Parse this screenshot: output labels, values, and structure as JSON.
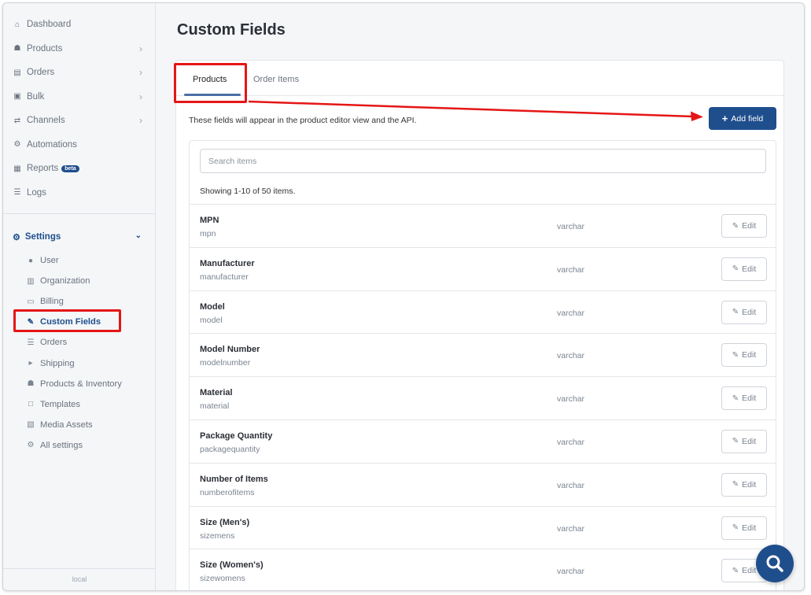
{
  "sidebar": {
    "nav": [
      {
        "label": "Dashboard",
        "icon": "home-icon"
      },
      {
        "label": "Products",
        "icon": "products-icon"
      },
      {
        "label": "Orders",
        "icon": "orders-icon"
      },
      {
        "label": "Bulk",
        "icon": "bulk-icon"
      },
      {
        "label": "Channels",
        "icon": "channels-icon"
      },
      {
        "label": "Automations",
        "icon": "automations-icon"
      },
      {
        "label": "Reports",
        "icon": "reports-icon",
        "badge": "beta"
      },
      {
        "label": "Logs",
        "icon": "logs-icon"
      }
    ],
    "settings": {
      "label": "Settings",
      "items": [
        {
          "label": "User"
        },
        {
          "label": "Organization"
        },
        {
          "label": "Billing"
        },
        {
          "label": "Custom Fields"
        },
        {
          "label": "Orders"
        },
        {
          "label": "Shipping"
        },
        {
          "label": "Products & Inventory"
        },
        {
          "label": "Templates"
        },
        {
          "label": "Media Assets"
        },
        {
          "label": "All settings"
        }
      ]
    },
    "footer": "local"
  },
  "main": {
    "title": "Custom Fields",
    "tabs": [
      {
        "label": "Products"
      },
      {
        "label": "Order Items"
      }
    ],
    "description": "These fields will appear in the product editor view and the API.",
    "add_button": "Add field",
    "search": {
      "placeholder": "Search items"
    },
    "showing": "Showing 1-10 of 50 items.",
    "edit_label": "Edit",
    "rows": [
      {
        "name": "MPN",
        "key": "mpn",
        "type": "varchar"
      },
      {
        "name": "Manufacturer",
        "key": "manufacturer",
        "type": "varchar"
      },
      {
        "name": "Model",
        "key": "model",
        "type": "varchar"
      },
      {
        "name": "Model Number",
        "key": "modelnumber",
        "type": "varchar"
      },
      {
        "name": "Material",
        "key": "material",
        "type": "varchar"
      },
      {
        "name": "Package Quantity",
        "key": "packagequantity",
        "type": "varchar"
      },
      {
        "name": "Number of Items",
        "key": "numberofitems",
        "type": "varchar"
      },
      {
        "name": "Size (Men's)",
        "key": "sizemens",
        "type": "varchar"
      },
      {
        "name": "Size (Women's)",
        "key": "sizewomens",
        "type": "varchar"
      }
    ]
  },
  "colors": {
    "accent": "#1f4e8c",
    "annotation": "#e51616"
  }
}
